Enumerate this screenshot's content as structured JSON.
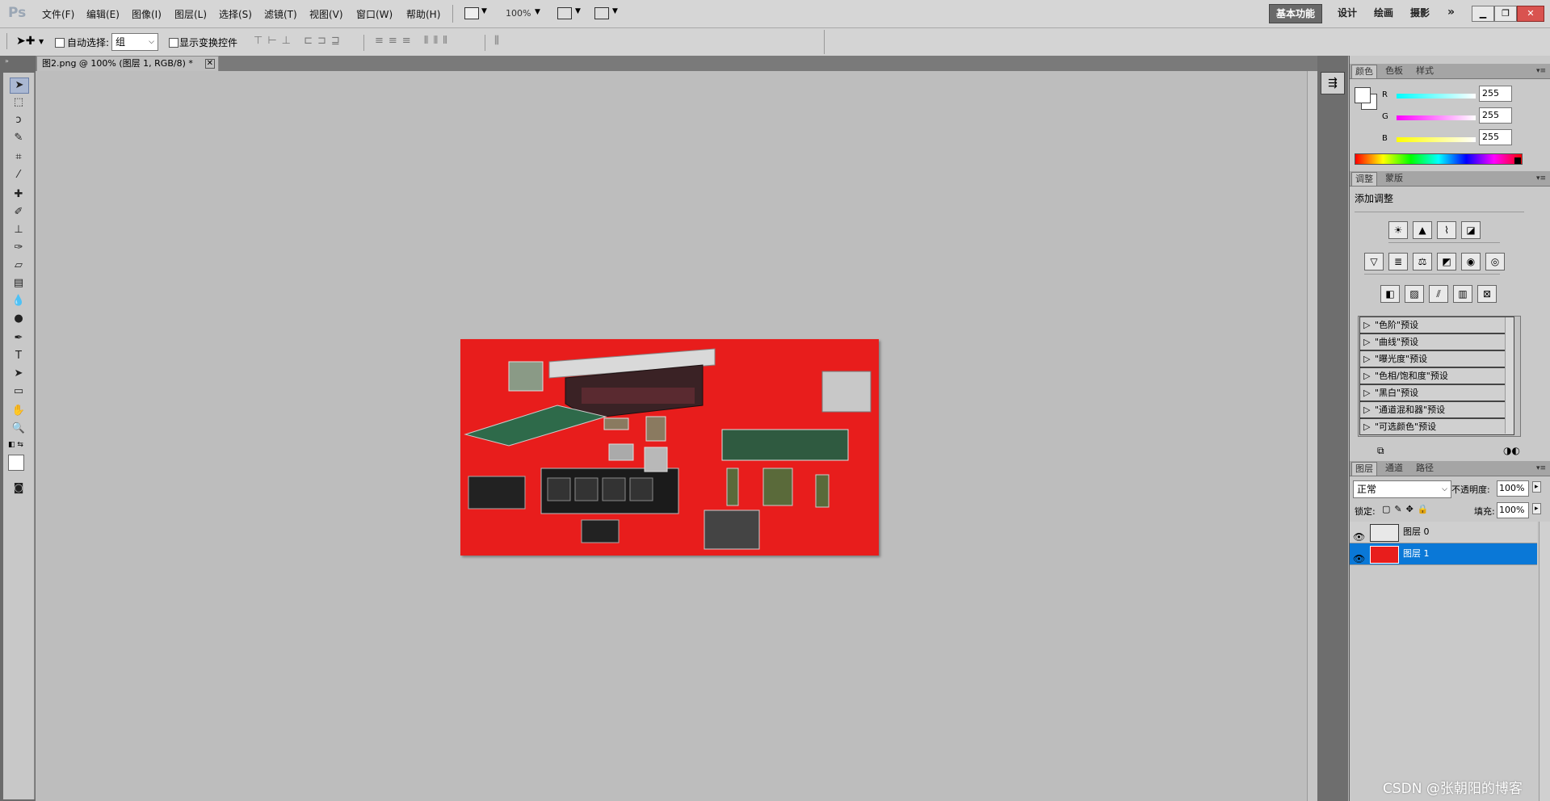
{
  "app": {
    "logo": "Ps",
    "menus": [
      "文件(F)",
      "编辑(E)",
      "图像(I)",
      "图层(L)",
      "选择(S)",
      "滤镜(T)",
      "视图(V)",
      "窗口(W)",
      "帮助(H)"
    ],
    "zoom": "100%",
    "workspaces": [
      "基本功能",
      "设计",
      "绘画",
      "摄影"
    ],
    "workspace_more": "»"
  },
  "options": {
    "auto_select_label": "自动选择:",
    "auto_select_value": "组",
    "show_transform_label": "显示变换控件"
  },
  "document": {
    "tab_title": "图2.png @ 100% (图层 1, RGB/8) *",
    "close_glyph": "✕",
    "image_bg": "#e81d1c"
  },
  "color_panel": {
    "tabs": [
      "颜色",
      "色板",
      "样式"
    ],
    "channels": [
      {
        "label": "R",
        "value": "255"
      },
      {
        "label": "G",
        "value": "255"
      },
      {
        "label": "B",
        "value": "255"
      }
    ]
  },
  "adjust_panel": {
    "tabs": [
      "调整",
      "蒙版"
    ],
    "title": "添加调整",
    "presets": [
      "\"色阶\"预设",
      "\"曲线\"预设",
      "\"曝光度\"预设",
      "\"色相/饱和度\"预设",
      "\"黑白\"预设",
      "\"通道混和器\"预设",
      "\"可选颜色\"预设"
    ]
  },
  "layers_panel": {
    "tabs": [
      "图层",
      "通道",
      "路径"
    ],
    "blend_mode": "正常",
    "opacity_label": "不透明度:",
    "opacity_value": "100%",
    "lock_label": "锁定:",
    "fill_label": "填充:",
    "fill_value": "100%",
    "layers": [
      {
        "name": "图层 0",
        "selected": false
      },
      {
        "name": "图层 1",
        "selected": true
      }
    ],
    "selected_color": "#0a78d7"
  },
  "watermark": "CSDN @张朝阳的博客"
}
